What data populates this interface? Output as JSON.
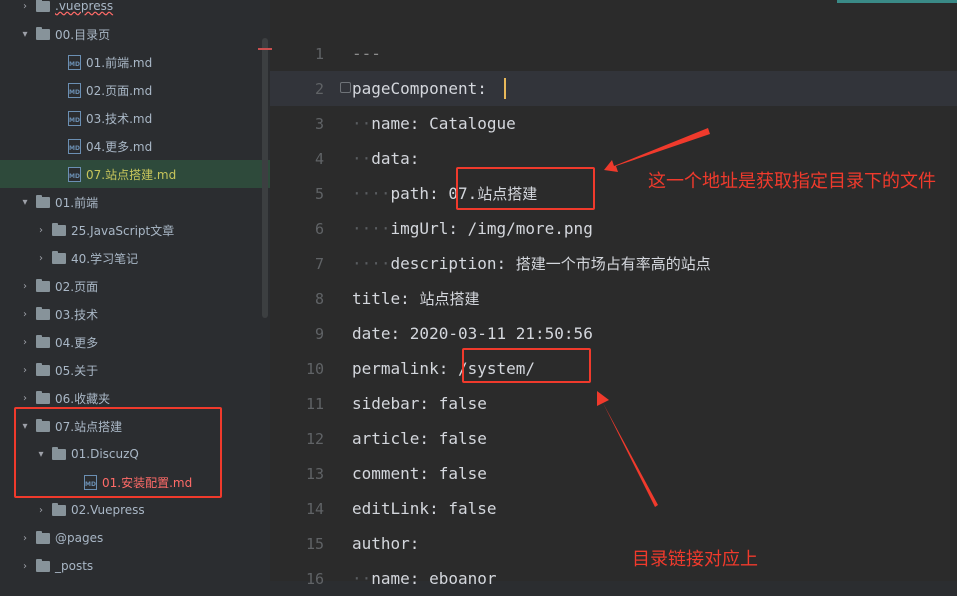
{
  "tree": {
    "items": [
      {
        "label": ".vuepress",
        "kind": "folder",
        "open": false,
        "indent": 1,
        "style": "err"
      },
      {
        "label": "00.目录页",
        "kind": "folder",
        "open": true,
        "indent": 1
      },
      {
        "label": "01.前端.md",
        "kind": "md",
        "indent": 3
      },
      {
        "label": "02.页面.md",
        "kind": "md",
        "indent": 3
      },
      {
        "label": "03.技术.md",
        "kind": "md",
        "indent": 3
      },
      {
        "label": "04.更多.md",
        "kind": "md",
        "indent": 3
      },
      {
        "label": "07.站点搭建.md",
        "kind": "md",
        "indent": 3,
        "style": "green",
        "selected": true
      },
      {
        "label": "01.前端",
        "kind": "folder",
        "open": true,
        "indent": 1
      },
      {
        "label": "25.JavaScript文章",
        "kind": "folder",
        "open": false,
        "indent": 2
      },
      {
        "label": "40.学习笔记",
        "kind": "folder",
        "open": false,
        "indent": 2
      },
      {
        "label": "02.页面",
        "kind": "folder",
        "open": false,
        "indent": 1
      },
      {
        "label": "03.技术",
        "kind": "folder",
        "open": false,
        "indent": 1
      },
      {
        "label": "04.更多",
        "kind": "folder",
        "open": false,
        "indent": 1
      },
      {
        "label": "05.关于",
        "kind": "folder",
        "open": false,
        "indent": 1
      },
      {
        "label": "06.收藏夹",
        "kind": "folder",
        "open": false,
        "indent": 1
      },
      {
        "label": "07.站点搭建",
        "kind": "folder",
        "open": true,
        "indent": 1
      },
      {
        "label": "01.DiscuzQ",
        "kind": "folder",
        "open": true,
        "indent": 2
      },
      {
        "label": "01.安装配置.md",
        "kind": "md",
        "indent": 4,
        "style": "red"
      },
      {
        "label": "02.Vuepress",
        "kind": "folder",
        "open": false,
        "indent": 2
      },
      {
        "label": "@pages",
        "kind": "folder",
        "open": false,
        "indent": 1
      },
      {
        "label": "_posts",
        "kind": "folder",
        "open": false,
        "indent": 1
      }
    ],
    "md_icon_text": "MD"
  },
  "editor": {
    "lines": [
      {
        "num": "1",
        "parts": [
          {
            "t": "---",
            "c": "#8c8c8c"
          }
        ]
      },
      {
        "num": "2",
        "parts": [
          {
            "t": "pageComponent:"
          }
        ]
      },
      {
        "num": "3",
        "parts": [
          {
            "t": "··",
            "ws": true
          },
          {
            "t": "name: Catalogue"
          }
        ]
      },
      {
        "num": "4",
        "parts": [
          {
            "t": "··",
            "ws": true
          },
          {
            "t": "data:"
          }
        ]
      },
      {
        "num": "5",
        "parts": [
          {
            "t": "····",
            "ws": true
          },
          {
            "t": "path: 07."
          },
          {
            "t": "站点搭建",
            "cn": true
          }
        ]
      },
      {
        "num": "6",
        "parts": [
          {
            "t": "····",
            "ws": true
          },
          {
            "t": "imgUrl: /img/more.png"
          }
        ]
      },
      {
        "num": "7",
        "parts": [
          {
            "t": "····",
            "ws": true
          },
          {
            "t": "description: "
          },
          {
            "t": "搭建一个市场占有率高的站点",
            "cn": true
          }
        ]
      },
      {
        "num": "8",
        "parts": [
          {
            "t": "title: "
          },
          {
            "t": "站点搭建",
            "cn": true
          }
        ]
      },
      {
        "num": "9",
        "parts": [
          {
            "t": "date: 2020-03-11 21:50:56"
          }
        ]
      },
      {
        "num": "10",
        "parts": [
          {
            "t": "permalink: /system/"
          }
        ]
      },
      {
        "num": "11",
        "parts": [
          {
            "t": "sidebar: false"
          }
        ]
      },
      {
        "num": "12",
        "parts": [
          {
            "t": "article: false"
          }
        ]
      },
      {
        "num": "13",
        "parts": [
          {
            "t": "comment: false"
          }
        ]
      },
      {
        "num": "14",
        "parts": [
          {
            "t": "editLink: false"
          }
        ]
      },
      {
        "num": "15",
        "parts": [
          {
            "t": "author:"
          }
        ]
      },
      {
        "num": "16",
        "parts": [
          {
            "t": "··",
            "ws": true
          },
          {
            "t": "name: eboanor"
          }
        ]
      }
    ]
  },
  "annotations": {
    "note_top": "这一个地址是获取指定目录下的文件",
    "note_bottom": "目录链接对应上",
    "color": "#f03a2c"
  }
}
